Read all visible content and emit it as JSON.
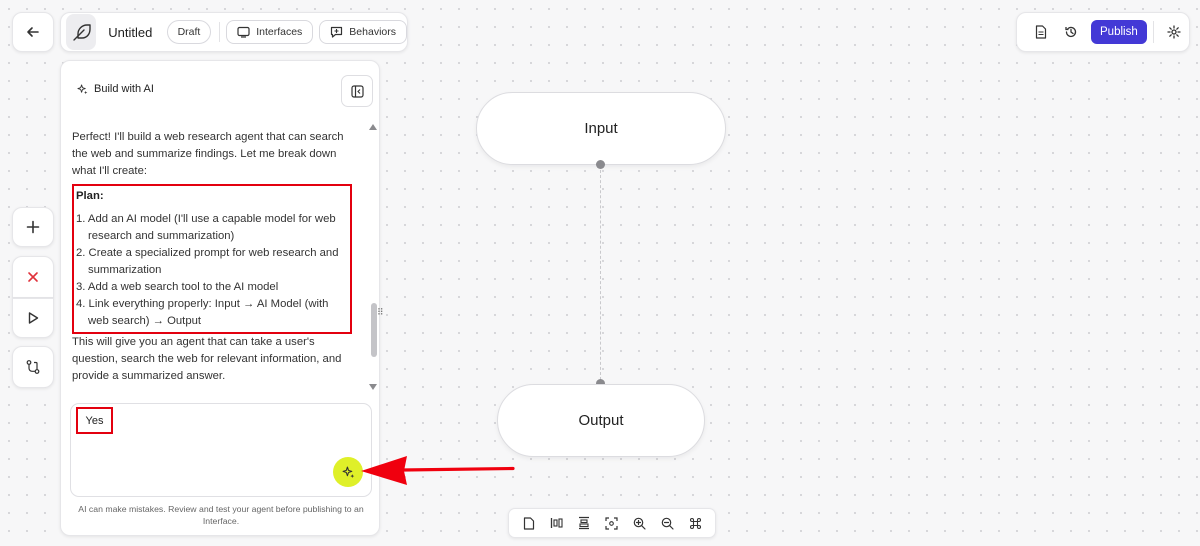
{
  "header": {
    "title": "Untitled",
    "draft_label": "Draft",
    "interfaces_label": "Interfaces",
    "behaviors_label": "Behaviors",
    "publish_label": "Publish"
  },
  "icons": {
    "back": "arrow-left-icon",
    "logo": "feather-icon",
    "interfaces": "monitor-icon",
    "behaviors": "chat-plus-icon",
    "document": "document-icon",
    "history": "history-icon",
    "settings": "gear-icon",
    "add": "plus-icon",
    "close": "close-icon",
    "run": "play-icon",
    "version_control": "git-branch-icon",
    "ai": "sparkle-icon",
    "collapse": "panel-collapse-icon"
  },
  "ai_panel": {
    "header": "Build with AI",
    "intro": "Perfect! I'll build a web research agent that can search the web and summarize findings. Let me break down what I'll create:",
    "plan_title": "Plan:",
    "plan_items": [
      "1. Add an AI model (I'll use a capable model for web research and summarization)",
      "2. Create a specialized prompt for web research and summarization",
      "3. Add a web search tool to the AI model",
      "4. Link everything properly: Input → AI Model (with web search) → Output"
    ],
    "summary": "This will give you an agent that can take a user's question, search the web for relevant information, and provide a summarized answer.",
    "input_value": "Yes",
    "disclaimer": "AI can make mistakes. Review and test your agent before publishing to an Interface."
  },
  "canvas": {
    "input_node": "Input",
    "output_node": "Output"
  },
  "colors": {
    "accent": "#4339d6",
    "annotation_red": "#e3000f",
    "send_button": "#dff029"
  }
}
